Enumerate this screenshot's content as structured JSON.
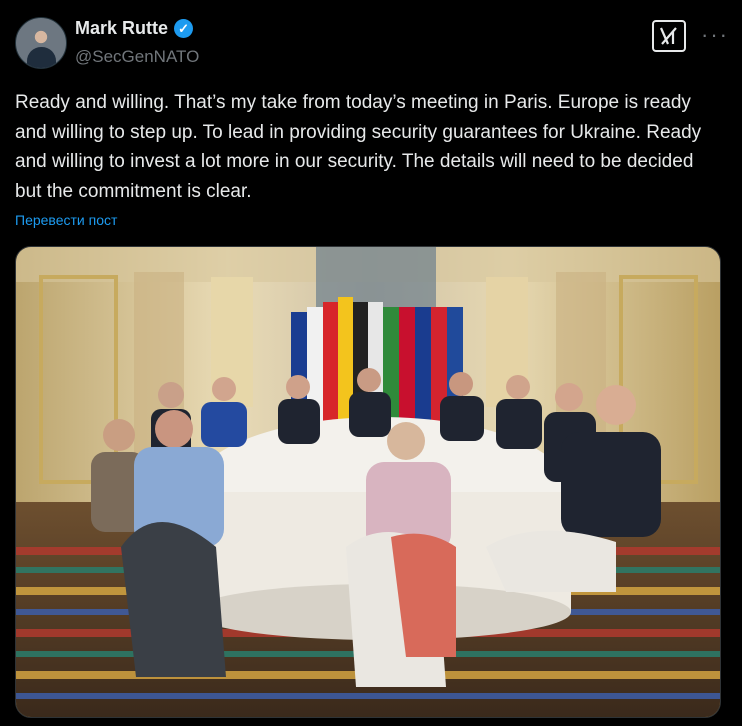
{
  "author": {
    "name": "Mark Rutte",
    "handle": "@SecGenNATO",
    "verified": true
  },
  "tweet": {
    "text": "Ready and willing. That’s my take from today’s meeting in Paris. Europe is ready and willing to step up. To lead in providing security guarantees for Ukraine. Ready and willing to invest a lot more in our security. The details will need  to be decided but the commitment is clear.",
    "translate_label": "Перевести пост"
  },
  "icons": {
    "grok": "grok-icon",
    "more": "more-icon",
    "verified": "verified-badge-icon"
  },
  "colors": {
    "background": "#000000",
    "text": "#e7e9ea",
    "muted": "#71767b",
    "accent": "#1d9bf0"
  }
}
